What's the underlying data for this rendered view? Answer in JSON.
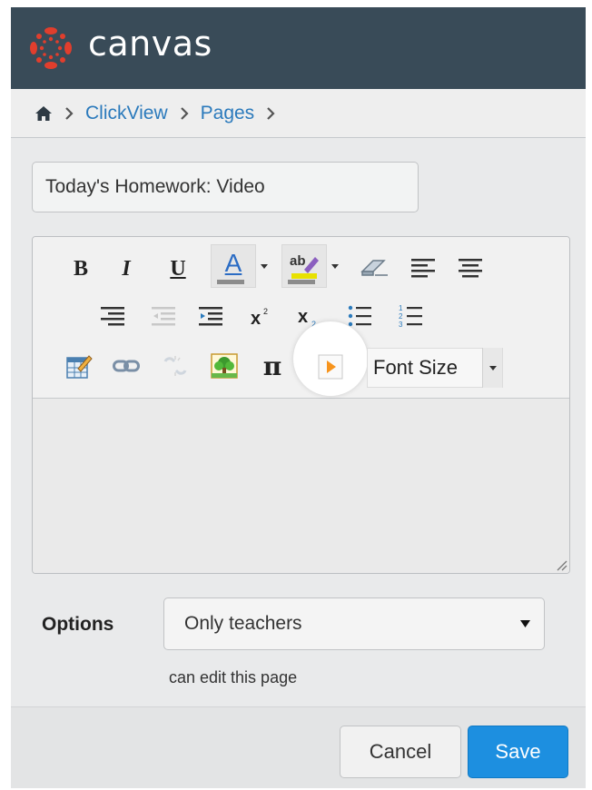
{
  "header": {
    "brand": "canvas",
    "logo_icon": "canvas-logo-icon",
    "background": "#394b58",
    "logo_color": "#e03e2d"
  },
  "breadcrumb": {
    "home_icon": "home-icon",
    "separator_icon": "chevron-right-icon",
    "items": [
      {
        "label": "ClickView"
      },
      {
        "label": "Pages"
      }
    ],
    "link_color": "#2b7abc"
  },
  "page_title": {
    "value": "Today's Homework: Video"
  },
  "toolbar": {
    "row1": [
      "bold-icon",
      "italic-icon",
      "underline-icon",
      "text-color-icon",
      "background-color-icon",
      "eraser-icon",
      "align-left-icon",
      "align-center-icon"
    ],
    "row2": [
      "align-right-icon",
      "outdent-icon",
      "indent-icon",
      "superscript-icon",
      "subscript-icon",
      "bullet-list-icon",
      "numbered-list-icon"
    ],
    "row3": [
      "edit-table-icon",
      "link-icon",
      "unlink-icon",
      "image-icon",
      "math-pi-icon",
      "clickview-play-icon"
    ],
    "bold_label": "B",
    "italic_label": "I",
    "underline_label": "U",
    "text_color_label": "A",
    "pi_label": "π",
    "font_size_label": "Font Size",
    "highlight_play_color": "#f7941d"
  },
  "options": {
    "label": "Options",
    "selected": "Only teachers",
    "hint": "can edit this page"
  },
  "footer": {
    "cancel_label": "Cancel",
    "save_label": "Save",
    "save_color": "#1d8fe0"
  }
}
